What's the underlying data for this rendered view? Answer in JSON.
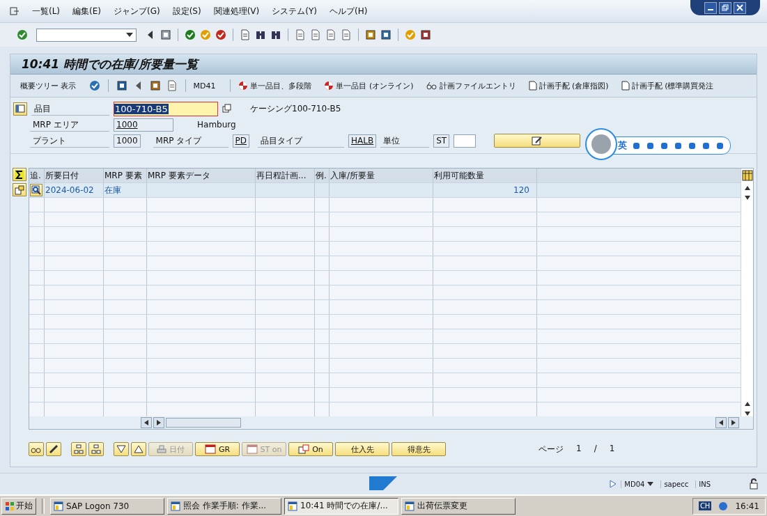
{
  "menu": [
    {
      "label": "一覧(L)"
    },
    {
      "label": "編集(E)"
    },
    {
      "label": "ジャンプ(G)"
    },
    {
      "label": "設定(S)"
    },
    {
      "label": "関連処理(V)"
    },
    {
      "label": "システム(Y)"
    },
    {
      "label": "ヘルプ(H)"
    }
  ],
  "title": "10:41 時間での在庫/所要量一覧",
  "app_toolbar": [
    {
      "label": "概要ツリー 表示",
      "kind": "plain"
    },
    {
      "label": "MD41",
      "kind": "plain"
    },
    {
      "label": "単一品目、多段階",
      "kind": "target"
    },
    {
      "label": "単一品目 (オンライン)",
      "kind": "target"
    },
    {
      "label": "計画ファイルエントリ",
      "kind": "glasses"
    },
    {
      "label": "計画手配 (倉庫指図)",
      "kind": "document"
    },
    {
      "label": "計画手配 (標準購買発注",
      "kind": "document"
    }
  ],
  "header": {
    "material": {
      "label": "品目",
      "value": "100-710-B5",
      "description": "ケーシング100-710-B5"
    },
    "mrp_area": {
      "label": "MRP エリア",
      "value": "1000",
      "description": "Hamburg"
    },
    "plant": {
      "label": "プラント",
      "value": "1000"
    },
    "mrp_type": {
      "label": "MRP タイプ",
      "value": "PD"
    },
    "material_type": {
      "label": "品目タイプ",
      "value": "HALB"
    },
    "unit": {
      "label": "単位",
      "value": "ST"
    }
  },
  "ime_bar": {
    "label": "英"
  },
  "table": {
    "columns": [
      "追.",
      "所要日付",
      "MRP 要素",
      "MRP 要素データ",
      "再日程計画...",
      "例.",
      "入庫/所要量",
      "利用可能数量"
    ],
    "rows": [
      {
        "cells": [
          "",
          "2024-06-02",
          "在庫",
          "",
          "",
          "",
          "",
          "120"
        ]
      }
    ]
  },
  "bottom_buttons": [
    {
      "label": "日付",
      "kind": "scale",
      "disabled": true
    },
    {
      "label": "GR",
      "kind": "calendar",
      "disabled": false
    },
    {
      "label": "ST on",
      "kind": "calendar",
      "disabled": true
    },
    {
      "label": "On",
      "kind": "flag",
      "disabled": false
    },
    {
      "label": "仕入先",
      "kind": "plain",
      "disabled": false
    },
    {
      "label": "得意先",
      "kind": "plain",
      "disabled": false
    }
  ],
  "pager": {
    "label": "ページ",
    "current": "1",
    "separator": "/",
    "total": "1"
  },
  "status_bar": {
    "transaction": "MD04",
    "system": "sapecc",
    "mode": "INS"
  },
  "taskbar": {
    "start": "开始",
    "tasks": [
      {
        "label": "SAP Logon 730",
        "selected": false
      },
      {
        "label": "照会 作業手順: 作業...",
        "selected": false
      },
      {
        "label": "10:41 時間での在庫/...",
        "selected": true
      },
      {
        "label": "出荷伝票変更",
        "selected": false
      }
    ],
    "language": "CH",
    "clock": "16:41"
  }
}
